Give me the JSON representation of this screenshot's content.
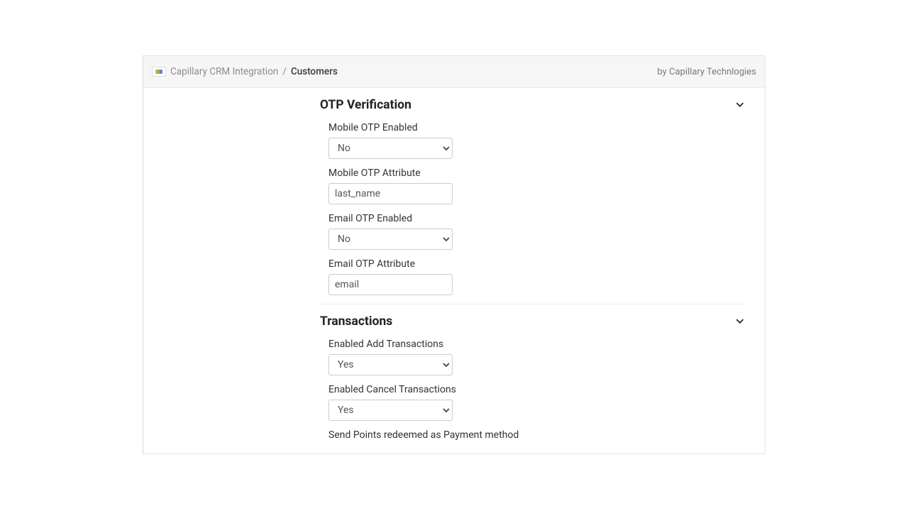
{
  "breadcrumb": {
    "app": "Capillary CRM Integration",
    "sep": "/",
    "page": "Customers"
  },
  "vendor": "by Capillary Technlogies",
  "sections": {
    "otp": {
      "title": "OTP Verification",
      "fields": {
        "mobile_enabled": {
          "label": "Mobile OTP Enabled",
          "value": "No"
        },
        "mobile_attr": {
          "label": "Mobile OTP Attribute",
          "value": "last_name"
        },
        "email_enabled": {
          "label": "Email OTP Enabled",
          "value": "No"
        },
        "email_attr": {
          "label": "Email OTP Attribute",
          "value": "email"
        }
      }
    },
    "tx": {
      "title": "Transactions",
      "fields": {
        "add_enabled": {
          "label": "Enabled Add Transactions",
          "value": "Yes"
        },
        "cancel_enabled": {
          "label": "Enabled Cancel Transactions",
          "value": "Yes"
        },
        "points_payment": {
          "label": "Send Points redeemed as Payment method"
        }
      }
    }
  },
  "select_options": {
    "yes_no": [
      "Yes",
      "No"
    ]
  }
}
